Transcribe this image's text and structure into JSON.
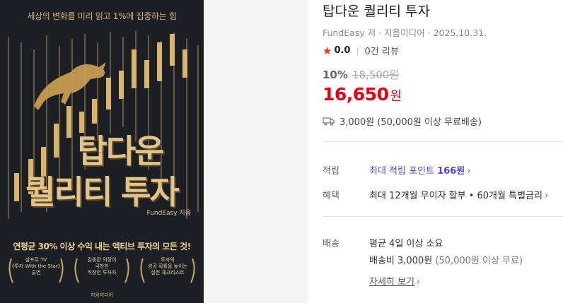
{
  "cover": {
    "top_text": "세상의 변화를 미리 읽고 1%에 집중하는 힘",
    "title_line1": "탑다운",
    "title_line2": "퀄리티 투자",
    "author": "FundEasy 지음",
    "slogan": "연평균 30% 이상 수익 내는 액티브 투자의 모든 것!",
    "laurels": [
      "삼프로 TV\n《투자 With the Star》\n출연",
      "김동환 의장이\n극찬한\n직장인 투자자",
      "투자의\n성공 확률을 높이는\n실전 체크리스트"
    ],
    "publisher": "지음미디어",
    "colors": {
      "gold": "#d9b46b",
      "background": "#1c1f24"
    }
  },
  "product": {
    "title": "탑다운 퀄리티 투자",
    "meta": "FundEasy 저 · 지음미디어 · 2025.10.31.",
    "rating_icon": "star-icon",
    "rating": "0.0",
    "reviews": "0건 리뷰",
    "discount_pct": "10%",
    "original_price": "18,500원",
    "price": "16,650",
    "price_unit": "원",
    "shipping_icon": "truck-icon",
    "shipping": "3,000원 (50,000원 이상 무료배송)"
  },
  "benefits": {
    "points_label": "적립",
    "points_text": "최대 적립 포인트",
    "points_value": "166원",
    "card_label": "혜택",
    "card_text": "최대 12개월 무이자 할부 • 60개월 특별금리"
  },
  "delivery": {
    "label": "배송",
    "eta": "평균 4일 이상 소요",
    "fee_label": "배송비 3,000원",
    "fee_note": "(50,000원 이상 무료)",
    "more_link": "자세히 보기"
  },
  "colors": {
    "price": "#e60012",
    "points": "#5a3fd6",
    "star": "#e8322f"
  }
}
